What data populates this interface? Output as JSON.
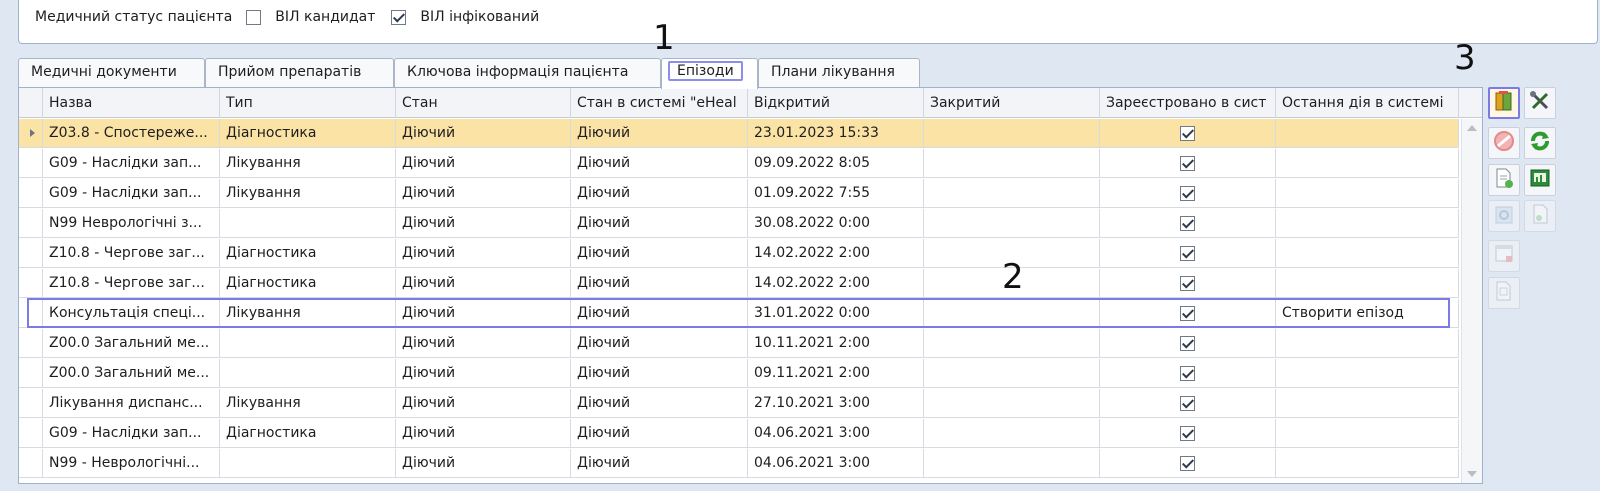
{
  "top": {
    "label": "Медичний статус пацієнта",
    "hiv_candidate": {
      "label": "ВІЛ кандидат",
      "checked": false
    },
    "hiv_infected": {
      "label": "ВІЛ інфікований",
      "checked": true
    }
  },
  "tabs": [
    {
      "label": "Медичні документи",
      "active": false
    },
    {
      "label": "Прийом препаратів",
      "active": false
    },
    {
      "label": "Ключова інформація пацієнта",
      "active": false
    },
    {
      "label": "Епізоди",
      "active": true
    },
    {
      "label": "Плани лікування",
      "active": false
    }
  ],
  "grid": {
    "columns": [
      "Назва",
      "Тип",
      "Стан",
      "Стан в системі \"eHeal",
      "Відкритий",
      "Закритий",
      "Зареєстровано в сист",
      "Остання дія в системі"
    ],
    "rows": [
      {
        "name": "Z03.8 - Спостереже...",
        "type": "Діагностика",
        "state": "Діючий",
        "ehealth_state": "Діючий",
        "opened": "23.01.2023 15:33",
        "closed": "",
        "registered": true,
        "last_action": ""
      },
      {
        "name": "G09 - Наслідки зап...",
        "type": "Лікування",
        "state": "Діючий",
        "ehealth_state": "Діючий",
        "opened": "09.09.2022 8:05",
        "closed": "",
        "registered": true,
        "last_action": ""
      },
      {
        "name": "G09 - Наслідки зап...",
        "type": "Лікування",
        "state": "Діючий",
        "ehealth_state": "Діючий",
        "opened": "01.09.2022 7:55",
        "closed": "",
        "registered": true,
        "last_action": ""
      },
      {
        "name": "N99 Неврологічні з...",
        "type": "",
        "state": "Діючий",
        "ehealth_state": "Діючий",
        "opened": "30.08.2022 0:00",
        "closed": "",
        "registered": true,
        "last_action": ""
      },
      {
        "name": "Z10.8 - Чергове заг...",
        "type": "Діагностика",
        "state": "Діючий",
        "ehealth_state": "Діючий",
        "opened": "14.02.2022 2:00",
        "closed": "",
        "registered": true,
        "last_action": ""
      },
      {
        "name": "Z10.8 - Чергове заг...",
        "type": "Діагностика",
        "state": "Діючий",
        "ehealth_state": "Діючий",
        "opened": "14.02.2022 2:00",
        "closed": "",
        "registered": true,
        "last_action": ""
      },
      {
        "name": "Консультація спеці...",
        "type": "Лікування",
        "state": "Діючий",
        "ehealth_state": "Діючий",
        "opened": "31.01.2022 0:00",
        "closed": "",
        "registered": true,
        "last_action": "Створити епізод"
      },
      {
        "name": "Z00.0 Загальний ме...",
        "type": "",
        "state": "Діючий",
        "ehealth_state": "Діючий",
        "opened": "10.11.2021 2:00",
        "closed": "",
        "registered": true,
        "last_action": ""
      },
      {
        "name": "Z00.0 Загальний ме...",
        "type": "",
        "state": "Діючий",
        "ehealth_state": "Діючий",
        "opened": "09.11.2021 2:00",
        "closed": "",
        "registered": true,
        "last_action": ""
      },
      {
        "name": "Лікування диспанс...",
        "type": "Лікування",
        "state": "Діючий",
        "ehealth_state": "Діючий",
        "opened": "27.10.2021 3:00",
        "closed": "",
        "registered": true,
        "last_action": ""
      },
      {
        "name": "G09 - Наслідки зап...",
        "type": "Діагностика",
        "state": "Діючий",
        "ehealth_state": "Діючий",
        "opened": "04.06.2021 3:00",
        "closed": "",
        "registered": true,
        "last_action": ""
      },
      {
        "name": "N99 - Неврологічні...",
        "type": "",
        "state": "Діючий",
        "ehealth_state": "Діючий",
        "opened": "04.06.2021 3:00",
        "closed": "",
        "registered": true,
        "last_action": ""
      }
    ]
  },
  "toolbar": [
    {
      "name": "episode-book-button",
      "icon": "book-icon",
      "enabled": true,
      "active": true
    },
    {
      "name": "edit-tools-button",
      "icon": "tools-icon",
      "enabled": true
    },
    {
      "name": "cancel-button",
      "icon": "forbidden-icon",
      "enabled": false
    },
    {
      "name": "refresh-button",
      "icon": "refresh-icon",
      "enabled": true
    },
    {
      "name": "new-document-button",
      "icon": "new-document-icon",
      "enabled": true
    },
    {
      "name": "chart-button",
      "icon": "chart-icon",
      "enabled": true
    },
    {
      "name": "recycle-button",
      "icon": "recycle-icon",
      "enabled": false
    },
    {
      "name": "document-link-button",
      "icon": "document-link-icon",
      "enabled": false
    },
    {
      "name": "window-close-button",
      "icon": "window-close-icon",
      "enabled": false
    },
    {
      "name": "document-refresh-button",
      "icon": "document-refresh-icon",
      "enabled": false
    }
  ],
  "annotations": [
    "1",
    "2",
    "3"
  ],
  "colors": {
    "selected_row": "#fbe3a6",
    "highlight": "#7c7be6"
  }
}
